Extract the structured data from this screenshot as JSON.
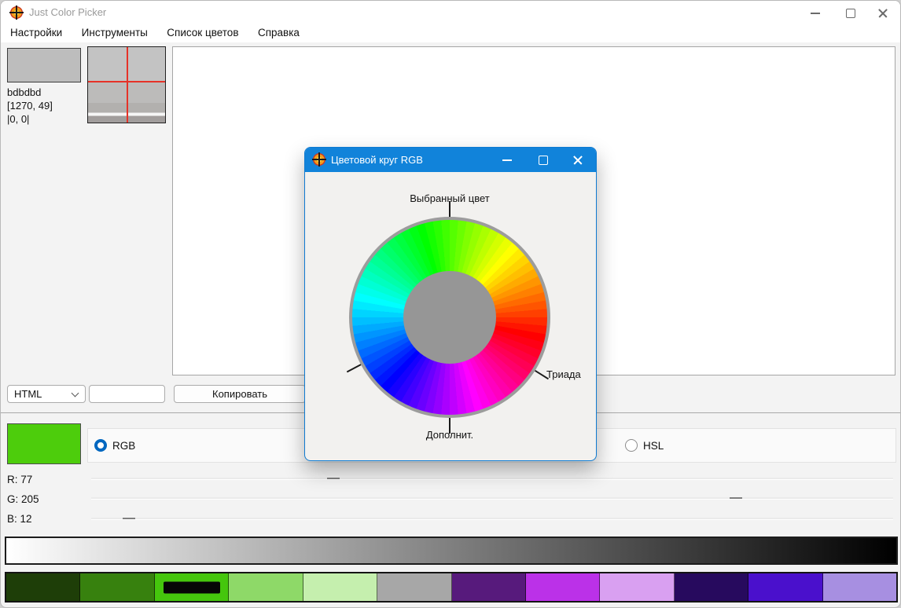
{
  "window": {
    "title": "Just Color Picker"
  },
  "menu": {
    "items": [
      {
        "label": "Настройки"
      },
      {
        "label": "Инструменты"
      },
      {
        "label": "Список цветов"
      },
      {
        "label": "Справка"
      }
    ]
  },
  "picker": {
    "hex": "bdbdbd",
    "swatch_color": "#bdbdbd",
    "coords": "[1270, 49]",
    "offset": "|0, 0|"
  },
  "format_row": {
    "format": "HTML",
    "input_value": "",
    "copy_label": "Копировать"
  },
  "color_panel": {
    "current_color": "#4dcd0c",
    "modes": {
      "rgb": {
        "label": "RGB",
        "selected": true
      },
      "hsl": {
        "label": "HSL",
        "selected": false
      }
    },
    "sliders": [
      {
        "label": "R: 77",
        "value": 77,
        "max": 255
      },
      {
        "label": "G: 205",
        "value": 205,
        "max": 255
      },
      {
        "label": "B: 12",
        "value": 12,
        "max": 255
      }
    ]
  },
  "gradient_bar": {
    "from": "#ffffff",
    "to": "#000000"
  },
  "palette": {
    "selected_index": 2,
    "colors": [
      "#1e3e08",
      "#37810e",
      "#45c60d",
      "#8ed968",
      "#c5efae",
      "#a7a7a7",
      "#571a7c",
      "#bb31e8",
      "#d9a0f1",
      "#270a5e",
      "#4a10cc",
      "#a78fe1"
    ]
  },
  "dialog": {
    "title": "Цветовой круг RGB",
    "selected_hue": 100,
    "segments": 72,
    "ring_color": "#9c9c9c",
    "center_color": "#969696",
    "titlebar_color": "#1183da",
    "labels": {
      "selected": "Выбранный цвет",
      "triad": "Триада",
      "complement": "Дополнит."
    }
  }
}
